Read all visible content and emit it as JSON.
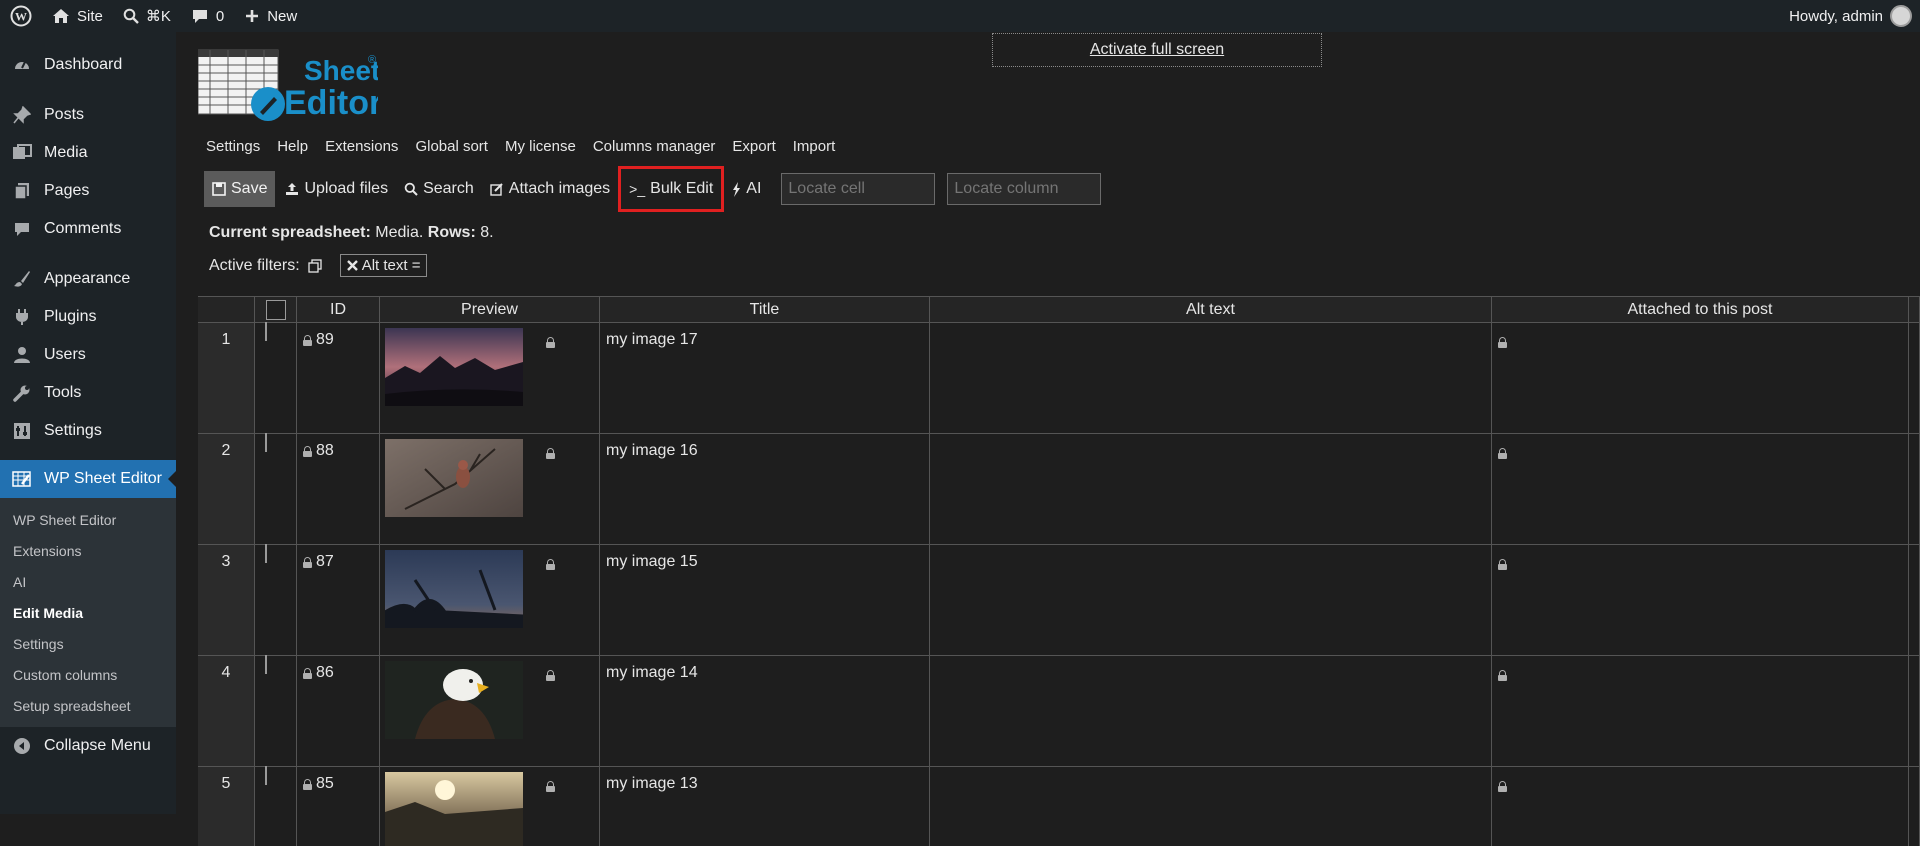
{
  "admin_bar": {
    "site": "Site",
    "search_shortcut": "⌘K",
    "comments_count": "0",
    "new_label": "New",
    "howdy": "Howdy, admin"
  },
  "sidebar": {
    "items": [
      {
        "label": "Dashboard",
        "icon": "dashboard-icon"
      },
      {
        "label": "Posts",
        "icon": "pushpin-icon"
      },
      {
        "label": "Media",
        "icon": "media-icon"
      },
      {
        "label": "Pages",
        "icon": "pages-icon"
      },
      {
        "label": "Comments",
        "icon": "comment-icon"
      },
      {
        "label": "Appearance",
        "icon": "paintbrush-icon"
      },
      {
        "label": "Plugins",
        "icon": "plug-icon"
      },
      {
        "label": "Users",
        "icon": "user-icon"
      },
      {
        "label": "Tools",
        "icon": "wrench-icon"
      },
      {
        "label": "Settings",
        "icon": "settings-icon"
      },
      {
        "label": "WP Sheet Editor",
        "icon": "spreadsheet-icon"
      }
    ],
    "submenu": [
      "WP Sheet Editor",
      "Extensions",
      "AI",
      "Edit Media",
      "Settings",
      "Custom columns",
      "Setup spreadsheet"
    ],
    "collapse": "Collapse Menu"
  },
  "logo": {
    "line1": "Sheet",
    "line2": "Editor",
    "mark": "®"
  },
  "fullscreen_label": "Activate full screen",
  "top_menu": [
    "Settings",
    "Help",
    "Extensions",
    "Global sort",
    "My license",
    "Columns manager",
    "Export",
    "Import"
  ],
  "toolbar": {
    "save": "Save",
    "upload": "Upload files",
    "search": "Search",
    "attach": "Attach images",
    "bulk_edit": "Bulk Edit",
    "bulk_prefix": ">_",
    "ai": "AI",
    "locate_cell_placeholder": "Locate cell",
    "locate_column_placeholder": "Locate column"
  },
  "sheet_info": {
    "label_current": "Current spreadsheet:",
    "current": "Media.",
    "label_rows": "Rows:",
    "rows": "8."
  },
  "filters": {
    "label": "Active filters:",
    "tag": "Alt text ="
  },
  "table": {
    "headers": [
      "ID",
      "Preview",
      "Title",
      "Alt text",
      "Attached to this post"
    ],
    "rows": [
      {
        "num": "1",
        "id": "89",
        "title": "my image 17"
      },
      {
        "num": "2",
        "id": "88",
        "title": "my image 16"
      },
      {
        "num": "3",
        "id": "87",
        "title": "my image 15"
      },
      {
        "num": "4",
        "id": "86",
        "title": "my image 14"
      },
      {
        "num": "5",
        "id": "85",
        "title": "my image 13"
      }
    ]
  },
  "colors": {
    "admin_bar": "#1d2327",
    "accent": "#2271b1",
    "logo_blue": "#1a8fc9",
    "highlight": "#e02020",
    "background": "#1e1e1e"
  }
}
